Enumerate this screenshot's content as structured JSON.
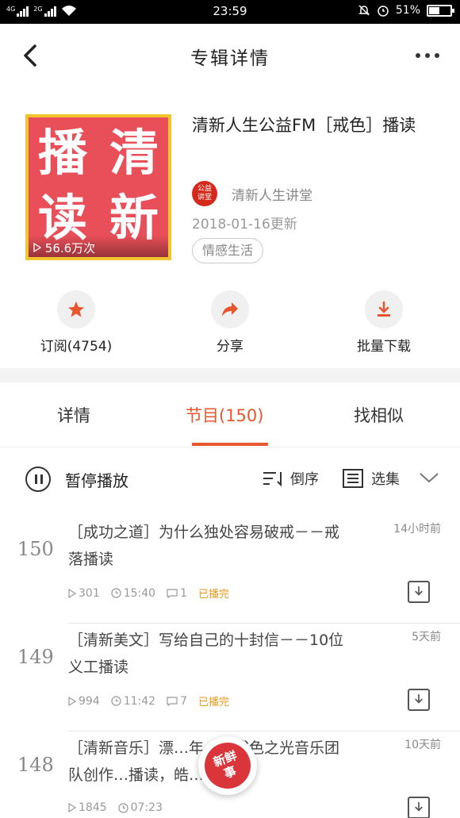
{
  "status_bar": {
    "net1": "4G",
    "net2": "2G",
    "time": "23:59",
    "battery": "51%",
    "battery_level": 0.51
  },
  "nav": {
    "title": "专辑详情"
  },
  "album": {
    "cover_glyphs": [
      "清",
      "新",
      "播",
      "读"
    ],
    "play_count": "56.6万次",
    "title": "清新人生公益FM［戒色］播读",
    "author_avatar_line1": "公益",
    "author_avatar_line2": "讲堂",
    "author_name": "清新人生讲堂",
    "updated": "2018-01-16更新",
    "tag": "情感生活"
  },
  "actions": {
    "subscribe": "订阅(4754)",
    "share": "分享",
    "batch_download": "批量下载"
  },
  "tabs": {
    "details": "详情",
    "programs": "节目(150)",
    "similar": "找相似"
  },
  "controls": {
    "pause_label": "暂停播放",
    "sort_label": "倒序",
    "select_label": "选集"
  },
  "episodes": [
    {
      "num": "150",
      "title": "［成功之道］为什么独处容易破戒－－戒落播读",
      "time_ago": "14小时前",
      "plays": "301",
      "duration": "15:40",
      "comments": "1",
      "status": "已播完"
    },
    {
      "num": "149",
      "title": "［清新美文］写给自己的十封信－－10位义工播读",
      "time_ago": "5天前",
      "plays": "994",
      "duration": "11:42",
      "comments": "7",
      "status": "已播完"
    },
    {
      "num": "148",
      "title": "［清新音乐］漂…年－－戒色之光音乐团队创作…播读，皓…",
      "time_ago": "10天前",
      "plays": "1845",
      "duration": "07:23",
      "comments": "",
      "status": ""
    }
  ],
  "float_badge": {
    "line1": "新鲜",
    "line2": "事"
  },
  "colors": {
    "accent": "#e8562e",
    "cover_red": "#e94f58",
    "cover_border": "#f2c530",
    "played": "#e79a1d"
  }
}
